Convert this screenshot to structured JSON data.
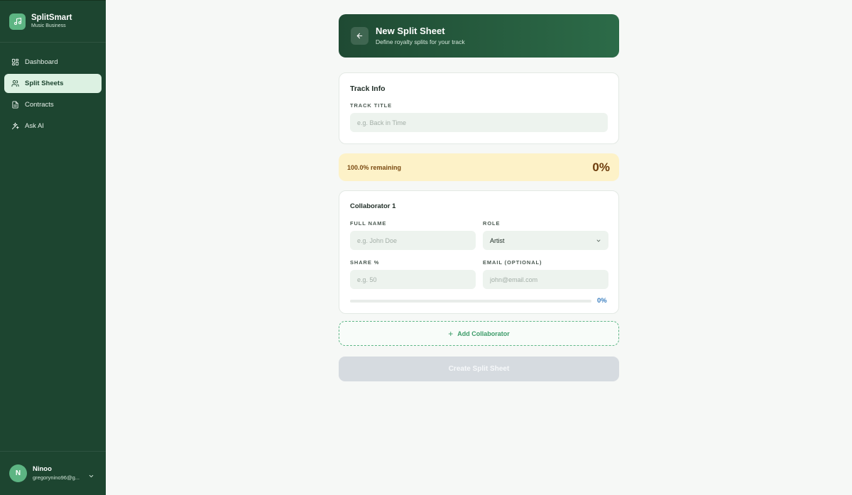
{
  "brand": {
    "name": "SplitSmart",
    "subtitle": "Music Business"
  },
  "nav": {
    "items": [
      {
        "label": "Dashboard",
        "icon": "grid-icon",
        "active": false
      },
      {
        "label": "Split Sheets",
        "icon": "users-icon",
        "active": true
      },
      {
        "label": "Contracts",
        "icon": "document-icon",
        "active": false
      },
      {
        "label": "Ask AI",
        "icon": "sparkles-icon",
        "active": false
      }
    ]
  },
  "user": {
    "initial": "N",
    "name": "Ninoo",
    "email": "gregorynino96@g..."
  },
  "header": {
    "title": "New Split Sheet",
    "subtitle": "Define royalty splits for your track"
  },
  "track": {
    "title": "Track Info",
    "field_label": "TRACK TITLE",
    "value": "",
    "placeholder": "e.g. Back in Time"
  },
  "remaining": {
    "text": "100.0% remaining",
    "allocated": "0%"
  },
  "collaborator": {
    "title": "Collaborator 1",
    "name_label": "FULL NAME",
    "name_value": "",
    "name_placeholder": "e.g. John Doe",
    "role_label": "ROLE",
    "role_value": "Artist",
    "share_label": "SHARE %",
    "share_value": "",
    "share_placeholder": "e.g. 50",
    "email_label": "EMAIL (OPTIONAL)",
    "email_value": "",
    "email_placeholder": "john@email.com",
    "share_progress": 0,
    "share_progress_label": "0%"
  },
  "actions": {
    "add_label": "Add Collaborator",
    "create_label": "Create Split Sheet"
  },
  "colors": {
    "sidebar": "#1d4530",
    "accent": "#5db583",
    "warning_bg": "#fdf2c8",
    "progress": "#3b7fc0"
  }
}
